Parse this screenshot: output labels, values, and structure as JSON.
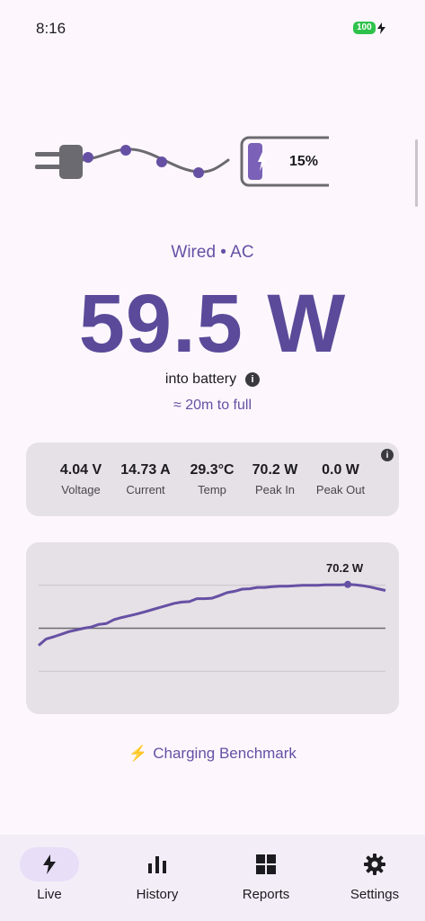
{
  "status_bar": {
    "time": "8:16",
    "battery_level": "100"
  },
  "hero": {
    "battery_percent": "15%",
    "level_fraction": 0.15
  },
  "connection_label": "Wired • AC",
  "power_value": "59.5 W",
  "power_caption": "into battery",
  "eta": "≈ 20m to full",
  "stats": [
    {
      "value": "4.04 V",
      "label": "Voltage"
    },
    {
      "value": "14.73 A",
      "label": "Current"
    },
    {
      "value": "29.3°C",
      "label": "Temp"
    },
    {
      "value": "70.2 W",
      "label": "Peak In"
    },
    {
      "value": "0.0 W",
      "label": "Peak Out"
    }
  ],
  "chart_data": {
    "type": "line",
    "series": [
      {
        "values": [
          56,
          57.5,
          58,
          58.6,
          59.2,
          59.6,
          60,
          60.3,
          60.9,
          61.1,
          62,
          62.5,
          62.9,
          63.3,
          63.8,
          64.3,
          64.8,
          65.3,
          65.8,
          66.1,
          66.2,
          66.9,
          66.9,
          67,
          67.6,
          68.3,
          68.6,
          69.1,
          69.2,
          69.5,
          69.5,
          69.7,
          69.8,
          69.8,
          69.9,
          70,
          70,
          70,
          70.1,
          70.1,
          70.1,
          70.2,
          70.1,
          69.9,
          69.6,
          69.2,
          68.8
        ]
      }
    ],
    "peak_label": "70.2 W",
    "peak_value": 70.2,
    "ylim": [
      40,
      80
    ],
    "zero_line_value": 60,
    "grid": true
  },
  "benchmark": {
    "icon": "⚡",
    "label": "Charging Benchmark"
  },
  "colors": {
    "accent": "#6650a4",
    "power": "#5b4a99",
    "battery_fill": "#7b62b8",
    "card": "#e6e1e6",
    "nav_pill": "#e8def8"
  },
  "nav": [
    {
      "label": "Live",
      "icon": "bolt-icon",
      "active": true
    },
    {
      "label": "History",
      "icon": "bar-chart-icon",
      "active": false
    },
    {
      "label": "Reports",
      "icon": "grid-icon",
      "active": false
    },
    {
      "label": "Settings",
      "icon": "gear-icon",
      "active": false
    }
  ]
}
